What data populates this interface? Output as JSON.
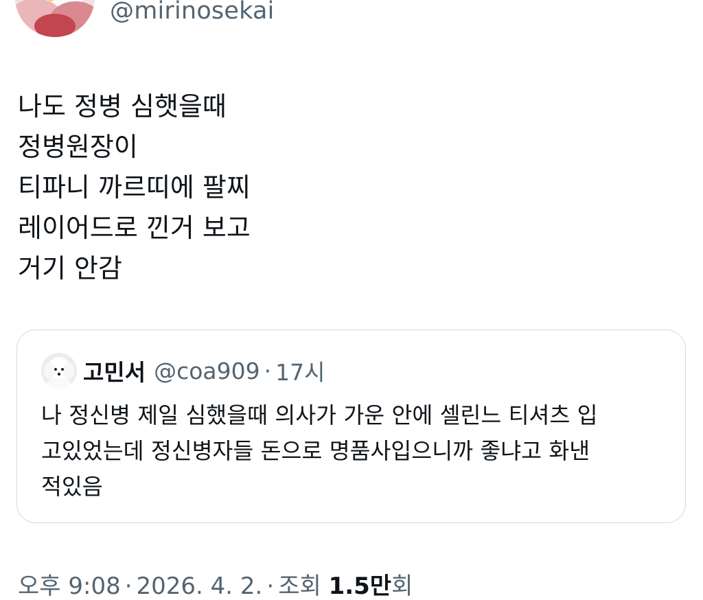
{
  "author": {
    "handle": "@mirinosekai"
  },
  "tweet": {
    "lines": [
      "나도 정병 심햇을때",
      "정병원장이",
      "티파니 까르띠에 팔찌",
      "레이어드로 낀거 보고",
      "거기 안감"
    ]
  },
  "quote": {
    "name": "고민서",
    "handle": "@coa909",
    "separator": "·",
    "time": "17시",
    "lines": [
      "나 정신병 제일 심했을때 의사가 가운 안에 셀린느 티셔츠 입",
      "고있었는데 정신병자들 돈으로 명품사입으니까 좋냐고 화낸",
      "적있음"
    ]
  },
  "meta": {
    "time": "오후 9:08",
    "separator": "·",
    "date": "2026. 4. 2.",
    "views_prefix": "조회",
    "views_number": "1.5만",
    "views_suffix": "회"
  }
}
